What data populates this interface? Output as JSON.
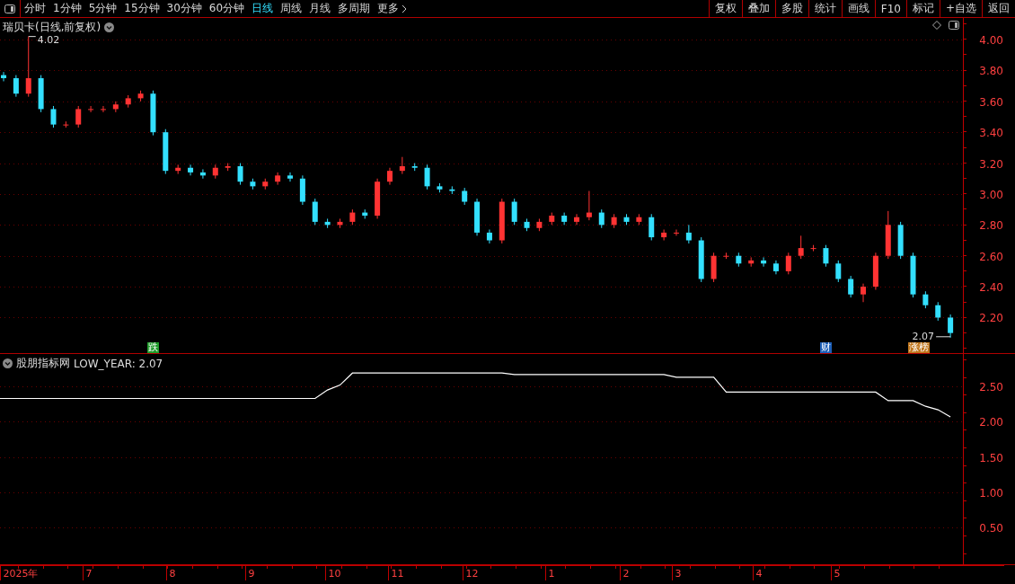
{
  "toolbar": {
    "periods": [
      {
        "label": "分时",
        "selected": false
      },
      {
        "label": "1分钟",
        "selected": false
      },
      {
        "label": "5分钟",
        "selected": false
      },
      {
        "label": "15分钟",
        "selected": false
      },
      {
        "label": "30分钟",
        "selected": false
      },
      {
        "label": "60分钟",
        "selected": false
      },
      {
        "label": "日线",
        "selected": true
      },
      {
        "label": "周线",
        "selected": false
      },
      {
        "label": "月线",
        "selected": false
      },
      {
        "label": "多周期",
        "selected": false
      }
    ],
    "more": "更多",
    "actions": [
      "复权",
      "叠加",
      "多股",
      "统计",
      "画线",
      "F10",
      "标记",
      "+自选",
      "返回"
    ]
  },
  "main_pane": {
    "title": "瑞贝卡(日线,前复权)",
    "chart_data": {
      "type": "candlestick",
      "grid": true,
      "ylim": [
        1.97,
        4.14
      ],
      "yticks": [
        {
          "value": 2.2,
          "label": "2.20"
        },
        {
          "value": 2.4,
          "label": "2.40"
        },
        {
          "value": 2.6,
          "label": "2.60"
        },
        {
          "value": 2.8,
          "label": "2.80"
        },
        {
          "value": 3.0,
          "label": "3.00"
        },
        {
          "value": 3.2,
          "label": "3.20"
        },
        {
          "value": 3.4,
          "label": "3.40"
        },
        {
          "value": 3.6,
          "label": "3.60"
        },
        {
          "value": 3.8,
          "label": "3.80"
        },
        {
          "value": 4.0,
          "label": "4.00"
        }
      ],
      "ohlc": [
        [
          3.77,
          3.79,
          3.73,
          3.75
        ],
        [
          3.75,
          3.77,
          3.63,
          3.65
        ],
        [
          3.65,
          4.02,
          3.63,
          3.75
        ],
        [
          3.75,
          3.77,
          3.53,
          3.55
        ],
        [
          3.55,
          3.57,
          3.43,
          3.45
        ],
        [
          3.45,
          3.47,
          3.43,
          3.45
        ],
        [
          3.45,
          3.57,
          3.43,
          3.55
        ],
        [
          3.55,
          3.57,
          3.53,
          3.55
        ],
        [
          3.55,
          3.57,
          3.53,
          3.55
        ],
        [
          3.55,
          3.6,
          3.53,
          3.58
        ],
        [
          3.58,
          3.64,
          3.56,
          3.62
        ],
        [
          3.62,
          3.67,
          3.6,
          3.65
        ],
        [
          3.65,
          3.67,
          3.38,
          3.4
        ],
        [
          3.4,
          3.42,
          3.13,
          3.15
        ],
        [
          3.15,
          3.19,
          3.13,
          3.17
        ],
        [
          3.17,
          3.19,
          3.12,
          3.14
        ],
        [
          3.14,
          3.16,
          3.1,
          3.12
        ],
        [
          3.12,
          3.19,
          3.1,
          3.17
        ],
        [
          3.17,
          3.2,
          3.15,
          3.18
        ],
        [
          3.18,
          3.2,
          3.06,
          3.08
        ],
        [
          3.08,
          3.1,
          3.03,
          3.05
        ],
        [
          3.05,
          3.1,
          3.03,
          3.08
        ],
        [
          3.08,
          3.14,
          3.06,
          3.12
        ],
        [
          3.12,
          3.14,
          3.08,
          3.1
        ],
        [
          3.1,
          3.12,
          2.93,
          2.95
        ],
        [
          2.95,
          2.97,
          2.8,
          2.82
        ],
        [
          2.82,
          2.84,
          2.78,
          2.8
        ],
        [
          2.8,
          2.84,
          2.78,
          2.82
        ],
        [
          2.82,
          2.9,
          2.8,
          2.88
        ],
        [
          2.88,
          2.9,
          2.84,
          2.86
        ],
        [
          2.86,
          3.1,
          2.84,
          3.08
        ],
        [
          3.08,
          3.17,
          3.06,
          3.15
        ],
        [
          3.15,
          3.24,
          3.13,
          3.18
        ],
        [
          3.18,
          3.2,
          3.15,
          3.17
        ],
        [
          3.17,
          3.19,
          3.03,
          3.05
        ],
        [
          3.05,
          3.07,
          3.01,
          3.03
        ],
        [
          3.03,
          3.05,
          3.0,
          3.02
        ],
        [
          3.02,
          3.04,
          2.93,
          2.95
        ],
        [
          2.95,
          2.97,
          2.73,
          2.75
        ],
        [
          2.75,
          2.77,
          2.68,
          2.7
        ],
        [
          2.7,
          2.97,
          2.68,
          2.95
        ],
        [
          2.95,
          2.97,
          2.8,
          2.82
        ],
        [
          2.82,
          2.84,
          2.76,
          2.78
        ],
        [
          2.78,
          2.84,
          2.76,
          2.82
        ],
        [
          2.82,
          2.88,
          2.8,
          2.86
        ],
        [
          2.86,
          2.88,
          2.8,
          2.82
        ],
        [
          2.82,
          2.87,
          2.8,
          2.85
        ],
        [
          2.85,
          3.02,
          2.83,
          2.88
        ],
        [
          2.88,
          2.9,
          2.78,
          2.8
        ],
        [
          2.8,
          2.87,
          2.78,
          2.85
        ],
        [
          2.85,
          2.87,
          2.8,
          2.82
        ],
        [
          2.82,
          2.87,
          2.8,
          2.85
        ],
        [
          2.85,
          2.87,
          2.7,
          2.72
        ],
        [
          2.72,
          2.77,
          2.7,
          2.75
        ],
        [
          2.75,
          2.77,
          2.73,
          2.75
        ],
        [
          2.75,
          2.8,
          2.68,
          2.7
        ],
        [
          2.7,
          2.72,
          2.43,
          2.45
        ],
        [
          2.45,
          2.62,
          2.43,
          2.6
        ],
        [
          2.6,
          2.62,
          2.58,
          2.6
        ],
        [
          2.6,
          2.62,
          2.53,
          2.55
        ],
        [
          2.55,
          2.59,
          2.53,
          2.57
        ],
        [
          2.57,
          2.59,
          2.53,
          2.55
        ],
        [
          2.55,
          2.57,
          2.48,
          2.5
        ],
        [
          2.5,
          2.62,
          2.48,
          2.6
        ],
        [
          2.6,
          2.73,
          2.58,
          2.65
        ],
        [
          2.65,
          2.67,
          2.63,
          2.65
        ],
        [
          2.65,
          2.67,
          2.53,
          2.55
        ],
        [
          2.55,
          2.57,
          2.43,
          2.45
        ],
        [
          2.45,
          2.47,
          2.33,
          2.35
        ],
        [
          2.35,
          2.42,
          2.3,
          2.4
        ],
        [
          2.4,
          2.62,
          2.38,
          2.6
        ],
        [
          2.6,
          2.89,
          2.58,
          2.8
        ],
        [
          2.8,
          2.82,
          2.58,
          2.6
        ],
        [
          2.6,
          2.62,
          2.33,
          2.35
        ],
        [
          2.35,
          2.37,
          2.26,
          2.28
        ],
        [
          2.28,
          2.3,
          2.18,
          2.2
        ],
        [
          2.2,
          2.22,
          2.07,
          2.1
        ]
      ],
      "annotations": [
        "4.02",
        "2.07"
      ]
    },
    "time_axis": [
      "2025年",
      "7",
      "8",
      "9",
      "10",
      "11",
      "12",
      "1",
      "2",
      "3",
      "4",
      "5"
    ],
    "signals": [
      {
        "label": "跌",
        "color": "#1f9a2a"
      },
      {
        "label": "财",
        "color": "#1d5fb8"
      },
      {
        "label": "涨榜",
        "color": "#c0761c"
      }
    ]
  },
  "indicator_pane": {
    "title": "股朋指标网",
    "reading": "LOW_YEAR: 2.07",
    "chart_data": {
      "type": "line",
      "grid": true,
      "ylim": [
        -0.03,
        2.96
      ],
      "yticks": [
        {
          "value": 0.5,
          "label": "0.50"
        },
        {
          "value": 1.0,
          "label": "1.00"
        },
        {
          "value": 1.5,
          "label": "1.50"
        },
        {
          "value": 2.0,
          "label": "2.00"
        },
        {
          "value": 2.5,
          "label": "2.50"
        }
      ],
      "series": [
        {
          "color": "#ffffff",
          "values": [
            2.33,
            2.33,
            2.33,
            2.33,
            2.33,
            2.33,
            2.33,
            2.33,
            2.33,
            2.33,
            2.33,
            2.33,
            2.33,
            2.33,
            2.33,
            2.33,
            2.33,
            2.33,
            2.33,
            2.33,
            2.33,
            2.33,
            2.33,
            2.33,
            2.33,
            2.33,
            2.45,
            2.52,
            2.69,
            2.69,
            2.69,
            2.69,
            2.69,
            2.69,
            2.69,
            2.69,
            2.69,
            2.69,
            2.69,
            2.69,
            2.69,
            2.67,
            2.67,
            2.67,
            2.67,
            2.67,
            2.67,
            2.67,
            2.67,
            2.67,
            2.67,
            2.67,
            2.67,
            2.67,
            2.63,
            2.63,
            2.63,
            2.63,
            2.42,
            2.42,
            2.42,
            2.42,
            2.42,
            2.42,
            2.42,
            2.42,
            2.42,
            2.42,
            2.42,
            2.42,
            2.42,
            2.3,
            2.3,
            2.3,
            2.22,
            2.17,
            2.07
          ]
        }
      ]
    }
  }
}
